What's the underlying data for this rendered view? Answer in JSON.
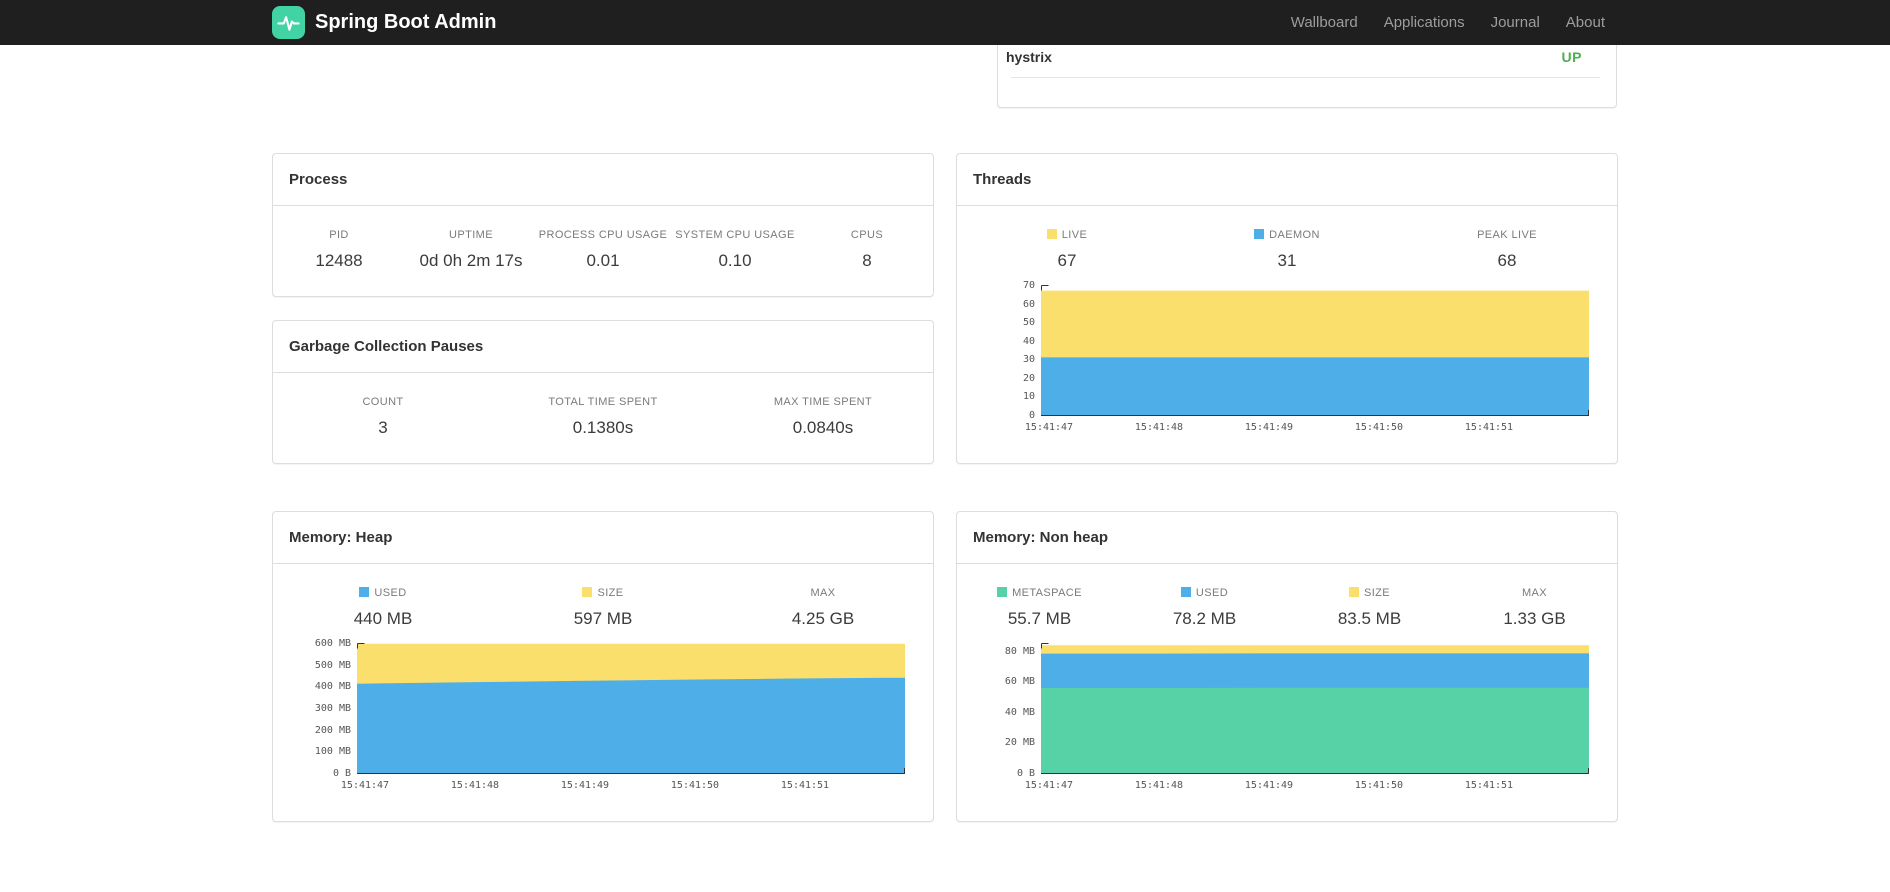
{
  "colors": {
    "brand_green": "#42d3a5",
    "status_up": "#4caf50",
    "series_yellow": "#fbdf6d",
    "series_blue": "#4daee8",
    "series_green": "#57d2a6"
  },
  "navbar": {
    "brand": "Spring Boot Admin",
    "links": [
      {
        "label": "Wallboard"
      },
      {
        "label": "Applications"
      },
      {
        "label": "Journal"
      },
      {
        "label": "About"
      }
    ]
  },
  "application": {
    "name": "hystrix",
    "status": "UP"
  },
  "panels": {
    "process": {
      "title": "Process",
      "metrics": [
        {
          "label": "PID",
          "value": "12488"
        },
        {
          "label": "UPTIME",
          "value": "0d 0h 2m 17s"
        },
        {
          "label": "PROCESS CPU USAGE",
          "value": "0.01"
        },
        {
          "label": "SYSTEM CPU USAGE",
          "value": "0.10"
        },
        {
          "label": "CPUS",
          "value": "8"
        }
      ]
    },
    "gc": {
      "title": "Garbage Collection Pauses",
      "metrics": [
        {
          "label": "COUNT",
          "value": "3"
        },
        {
          "label": "TOTAL TIME SPENT",
          "value": "0.1380s"
        },
        {
          "label": "MAX TIME SPENT",
          "value": "0.0840s"
        }
      ]
    },
    "threads": {
      "title": "Threads"
    },
    "heap": {
      "title": "Memory: Heap"
    },
    "nonheap": {
      "title": "Memory: Non heap"
    }
  },
  "chart_data": [
    {
      "id": "threads",
      "type": "area",
      "title": "Threads",
      "legend": [
        {
          "label": "LIVE",
          "value": "67",
          "color": "#fbdf6d"
        },
        {
          "label": "DAEMON",
          "value": "31",
          "color": "#4daee8"
        },
        {
          "label": "PEAK LIVE",
          "value": "68",
          "color": null
        }
      ],
      "x": [
        "15:41:47",
        "15:41:48",
        "15:41:49",
        "15:41:50",
        "15:41:51"
      ],
      "ylim": [
        0,
        70
      ],
      "yticks": [
        {
          "label": "0",
          "value": 0
        },
        {
          "label": "10",
          "value": 10
        },
        {
          "label": "20",
          "value": 20
        },
        {
          "label": "30",
          "value": 30
        },
        {
          "label": "40",
          "value": 40
        },
        {
          "label": "50",
          "value": 50
        },
        {
          "label": "60",
          "value": 60
        },
        {
          "label": "70",
          "value": 70
        }
      ],
      "series": [
        {
          "name": "LIVE",
          "color": "#fbdf6d",
          "values": [
            67,
            67,
            67,
            67,
            67,
            67
          ]
        },
        {
          "name": "DAEMON",
          "color": "#4daee8",
          "values": [
            31,
            31,
            31,
            31,
            31,
            31
          ]
        }
      ]
    },
    {
      "id": "heap",
      "type": "area",
      "title": "Memory: Heap",
      "legend": [
        {
          "label": "USED",
          "value": "440 MB",
          "color": "#4daee8"
        },
        {
          "label": "SIZE",
          "value": "597 MB",
          "color": "#fbdf6d"
        },
        {
          "label": "MAX",
          "value": "4.25 GB",
          "color": null
        }
      ],
      "x": [
        "15:41:47",
        "15:41:48",
        "15:41:49",
        "15:41:50",
        "15:41:51"
      ],
      "ylim": [
        0,
        600
      ],
      "unit": "MB",
      "yticks": [
        {
          "label": "0 B",
          "value": 0
        },
        {
          "label": "100 MB",
          "value": 100
        },
        {
          "label": "200 MB",
          "value": 200
        },
        {
          "label": "300 MB",
          "value": 300
        },
        {
          "label": "400 MB",
          "value": 400
        },
        {
          "label": "500 MB",
          "value": 500
        },
        {
          "label": "600 MB",
          "value": 600
        }
      ],
      "series": [
        {
          "name": "SIZE",
          "color": "#fbdf6d",
          "values": [
            597,
            597,
            597,
            597,
            597,
            597
          ]
        },
        {
          "name": "USED",
          "color": "#4daee8",
          "values": [
            412,
            419,
            425,
            431,
            436,
            440
          ]
        }
      ]
    },
    {
      "id": "nonheap",
      "type": "area",
      "title": "Memory: Non heap",
      "legend": [
        {
          "label": "METASPACE",
          "value": "55.7 MB",
          "color": "#57d2a6"
        },
        {
          "label": "USED",
          "value": "78.2 MB",
          "color": "#4daee8"
        },
        {
          "label": "SIZE",
          "value": "83.5 MB",
          "color": "#fbdf6d"
        },
        {
          "label": "MAX",
          "value": "1.33 GB",
          "color": null
        }
      ],
      "x": [
        "15:41:47",
        "15:41:48",
        "15:41:49",
        "15:41:50",
        "15:41:51"
      ],
      "ylim": [
        0,
        85
      ],
      "unit": "MB",
      "yticks": [
        {
          "label": "0 B",
          "value": 0
        },
        {
          "label": "20 MB",
          "value": 20
        },
        {
          "label": "40 MB",
          "value": 40
        },
        {
          "label": "60 MB",
          "value": 60
        },
        {
          "label": "80 MB",
          "value": 80
        }
      ],
      "series": [
        {
          "name": "SIZE",
          "color": "#fbdf6d",
          "values": [
            83.5,
            83.5,
            83.5,
            83.5,
            83.5,
            83.5
          ]
        },
        {
          "name": "USED",
          "color": "#4daee8",
          "values": [
            78.1,
            78.1,
            78.2,
            78.2,
            78.2,
            78.2
          ]
        },
        {
          "name": "METASPACE",
          "color": "#57d2a6",
          "values": [
            55.6,
            55.6,
            55.7,
            55.7,
            55.7,
            55.7
          ]
        }
      ]
    }
  ]
}
